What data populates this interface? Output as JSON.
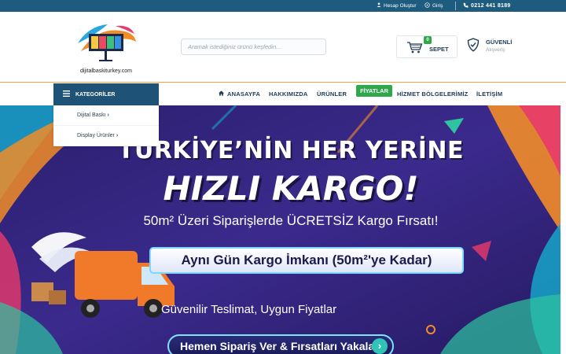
{
  "topbar": {
    "register": "Hesap Oluştur",
    "login": "Giriş",
    "phone": "0212 441 8189"
  },
  "header": {
    "logo_text": "dijitalbaskiturkey.com",
    "search_placeholder": "Aramak istediğiniz ürünü keşfedin...",
    "cart_label": "SEPET",
    "cart_count": "0",
    "secure_title": "GÜVENLİ",
    "secure_sub": "Alışveriş"
  },
  "nav": {
    "categories_label": "KATEGORİLER",
    "items": [
      "ANASAYFA",
      "HAKKIMIZDA",
      "ÜRÜNLER",
      "FİYATLAR",
      "HİZMET BÖLGELERİMİZ",
      "İLETİŞİM"
    ]
  },
  "dropdown": {
    "items": [
      "Dijital Baskı",
      "Display Ürünler"
    ]
  },
  "hero": {
    "line1": "TÜRKİYE’NİN HER YERİNE",
    "line2": "HIZLI KARGO!",
    "line3": "50m² Üzeri Siparişlerde ÜCRETSİZ Kargo Fırsatı!",
    "pill": "Aynı Gün Kargo İmkanı (50m²'ye Kadar)",
    "line4": "Güvenilir Teslimat, Uygun Fiyatlar",
    "cta": "Hemen Sipariş Ver & Fırsatları Yakala!"
  },
  "colors": {
    "topbar": "#1e5c7f",
    "nav_text": "#1d3b58",
    "accent_green": "#2ea84a",
    "accent_orange": "#f2a33a"
  }
}
